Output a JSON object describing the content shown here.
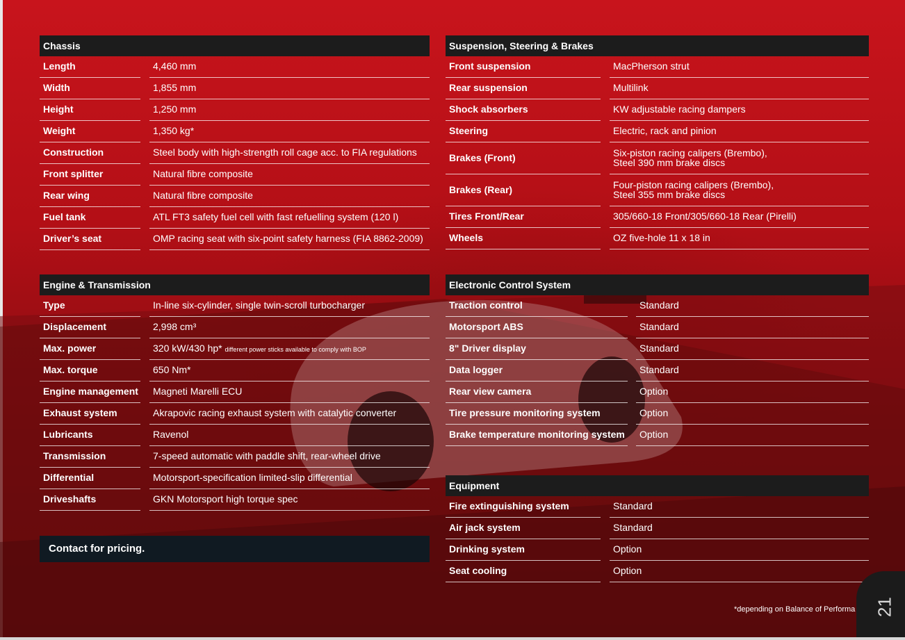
{
  "chassis": {
    "title": "Chassis",
    "rows": [
      {
        "label": "Length",
        "value": "4,460 mm"
      },
      {
        "label": "Width",
        "value": "1,855 mm"
      },
      {
        "label": "Height",
        "value": "1,250 mm"
      },
      {
        "label": "Weight",
        "value": "1,350 kg*"
      },
      {
        "label": "Construction",
        "value": "Steel body with high-strength roll cage acc. to FIA regulations"
      },
      {
        "label": "Front splitter",
        "value": "Natural fibre composite"
      },
      {
        "label": "Rear wing",
        "value": "Natural fibre composite"
      },
      {
        "label": "Fuel tank",
        "value": "ATL FT3 safety fuel cell with fast refuelling system (120 l)"
      },
      {
        "label": "Driver’s seat",
        "value": "OMP racing seat with six-point safety harness (FIA 8862-2009)"
      }
    ]
  },
  "suspension": {
    "title": "Suspension, Steering & Brakes",
    "rows": [
      {
        "label": "Front suspension",
        "value": "MacPherson strut"
      },
      {
        "label": "Rear suspension",
        "value": "Multilink"
      },
      {
        "label": "Shock absorbers",
        "value": "KW adjustable racing dampers"
      },
      {
        "label": "Steering",
        "value": "Electric, rack and pinion"
      },
      {
        "label": "Brakes (Front)",
        "value": "Six-piston racing calipers (Brembo),",
        "value2": "Steel 390 mm brake discs"
      },
      {
        "label": "Brakes (Rear)",
        "value": "Four-piston racing calipers (Brembo),",
        "value2": "Steel 355 mm brake discs"
      },
      {
        "label": "Tires Front/Rear",
        "value": "305/660-18 Front/305/660-18 Rear (Pirelli)"
      },
      {
        "label": "Wheels",
        "value": "OZ five-hole 11 x 18 in"
      }
    ]
  },
  "engine": {
    "title": "Engine & Transmission",
    "rows": [
      {
        "label": "Type",
        "value": "In-line six-cylinder, single twin-scroll turbocharger"
      },
      {
        "label": "Displacement",
        "value": "2,998 cm³"
      },
      {
        "label": "Max. power",
        "value": "320 kW/430 hp*",
        "note": "different power sticks available to comply with BOP"
      },
      {
        "label": "Max. torque",
        "value": "650 Nm*"
      },
      {
        "label": "Engine management",
        "value": "Magneti Marelli ECU"
      },
      {
        "label": "Exhaust system",
        "value": "Akrapovic racing exhaust system with catalytic converter"
      },
      {
        "label": "Lubricants",
        "value": "Ravenol"
      },
      {
        "label": "Transmission",
        "value": "7-speed automatic with paddle shift, rear-wheel drive"
      },
      {
        "label": "Differential",
        "value": "Motorsport-specification limited-slip differential"
      },
      {
        "label": "Driveshafts",
        "value": "GKN Motorsport high torque spec"
      }
    ]
  },
  "electronic": {
    "title": "Electronic Control System",
    "rows": [
      {
        "label": "Traction control",
        "value": "Standard"
      },
      {
        "label": "Motorsport ABS",
        "value": "Standard"
      },
      {
        "label": "8\" Driver display",
        "value": "Standard"
      },
      {
        "label": "Data logger",
        "value": "Standard"
      },
      {
        "label": "Rear view camera",
        "value": "Option"
      },
      {
        "label": "Tire pressure monitoring system",
        "value": "Option"
      },
      {
        "label": "Brake temperature monitoring system",
        "value": "Option"
      }
    ]
  },
  "equipment": {
    "title": "Equipment",
    "rows": [
      {
        "label": "Fire extinguishing system",
        "value": "Standard"
      },
      {
        "label": "Air jack system",
        "value": "Standard"
      },
      {
        "label": "Drinking system",
        "value": "Option"
      },
      {
        "label": "Seat cooling",
        "value": "Option"
      }
    ]
  },
  "contact": "Contact for pricing.",
  "footnote": "*depending on Balance of Performa",
  "page_number": "21"
}
